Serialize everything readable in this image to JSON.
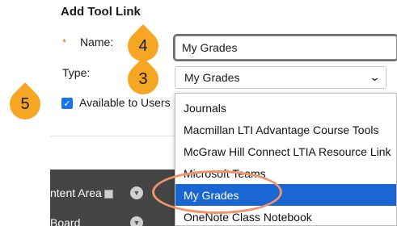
{
  "form": {
    "title": "Add Tool Link",
    "required_marker": "*",
    "name_label": "Name:",
    "name_value": "My Grades",
    "type_label": "Type:",
    "type_value": "My Grades",
    "available_label": "Available to Users",
    "available_checked": true
  },
  "dropdown": {
    "options": [
      "Journals",
      "Macmillan LTI Advantage Course Tools",
      "McGraw Hill Connect LTIA Resource Link",
      "Microsoft Teams",
      "My Grades",
      "OneNote Class Notebook"
    ],
    "selected": "My Grades"
  },
  "background_nav": {
    "items": [
      "ntent Area",
      "Board"
    ]
  },
  "callouts": {
    "step_name": "4",
    "step_type": "3",
    "step_available": "5"
  },
  "colors": {
    "callout": "#f5a623",
    "highlight_ring": "#f0956b",
    "selected_option": "#1a66d2",
    "checkbox": "#1a73e8",
    "nav_background": "#454545"
  }
}
